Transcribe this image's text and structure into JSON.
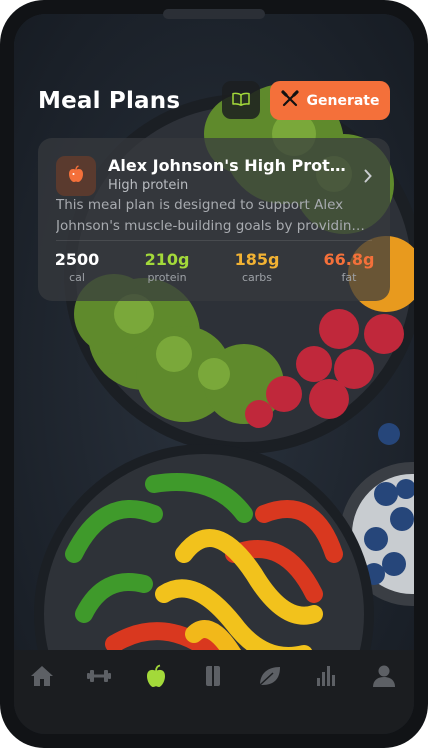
{
  "header": {
    "title": "Meal Plans",
    "generate_label": "Generate"
  },
  "plan_card": {
    "title": "Alex Johnson's High Protein...",
    "subtitle": "High protein",
    "description_line1": "This meal plan is designed to support Alex",
    "description_line2": "Johnson's muscle-building goals by providing ...",
    "stats": [
      {
        "value": "2500",
        "label": "cal",
        "color": "#ffffff"
      },
      {
        "value": "210g",
        "label": "protein",
        "color": "#a3d93a"
      },
      {
        "value": "185g",
        "label": "carbs",
        "color": "#f2b233"
      },
      {
        "value": "66.8g",
        "label": "fat",
        "color": "#f4703a"
      }
    ]
  },
  "tabs": [
    {
      "icon": "home-icon",
      "active": false
    },
    {
      "icon": "dumbbell-icon",
      "active": false
    },
    {
      "icon": "apple-icon",
      "active": true
    },
    {
      "icon": "book-icon",
      "active": false
    },
    {
      "icon": "leaf-icon",
      "active": false
    },
    {
      "icon": "bar-chart-icon",
      "active": false
    },
    {
      "icon": "person-icon",
      "active": false
    }
  ],
  "colors": {
    "accent": "#f4703a",
    "active_tab": "#a3d93a"
  }
}
